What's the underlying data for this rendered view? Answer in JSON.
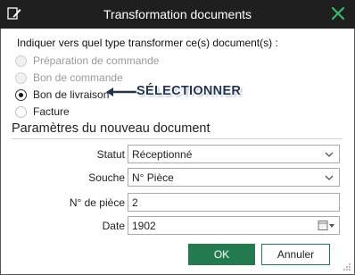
{
  "window": {
    "title": "Transformation documents",
    "icon": "pencil-icon",
    "close_icon": "close-x-icon"
  },
  "question": "Indiquer vers quel type transformer ce(s) document(s) :",
  "document_types": [
    {
      "label": "Préparation de commande",
      "state": "disabled"
    },
    {
      "label": "Bon de commande",
      "state": "disabled"
    },
    {
      "label": "Bon de livraison",
      "state": "checked"
    },
    {
      "label": "Facture",
      "state": "enabled"
    }
  ],
  "annotation": {
    "text": "SÉLECTIONNER",
    "color": "#23344f"
  },
  "section_title": "Paramètres du nouveau document",
  "fields": {
    "statut": {
      "label": "Statut",
      "value": "Réceptionné"
    },
    "souche": {
      "label": "Souche",
      "value": "N° Pièce"
    },
    "piece": {
      "label": "N° de pièce",
      "value": "2"
    },
    "date": {
      "label": "Date",
      "value": "1902"
    }
  },
  "buttons": {
    "ok": "OK",
    "cancel": "Annuler"
  },
  "colors": {
    "titlebar": "#1f1f1f",
    "accent_green": "#227a4e",
    "close_x": "#3cb66b"
  }
}
